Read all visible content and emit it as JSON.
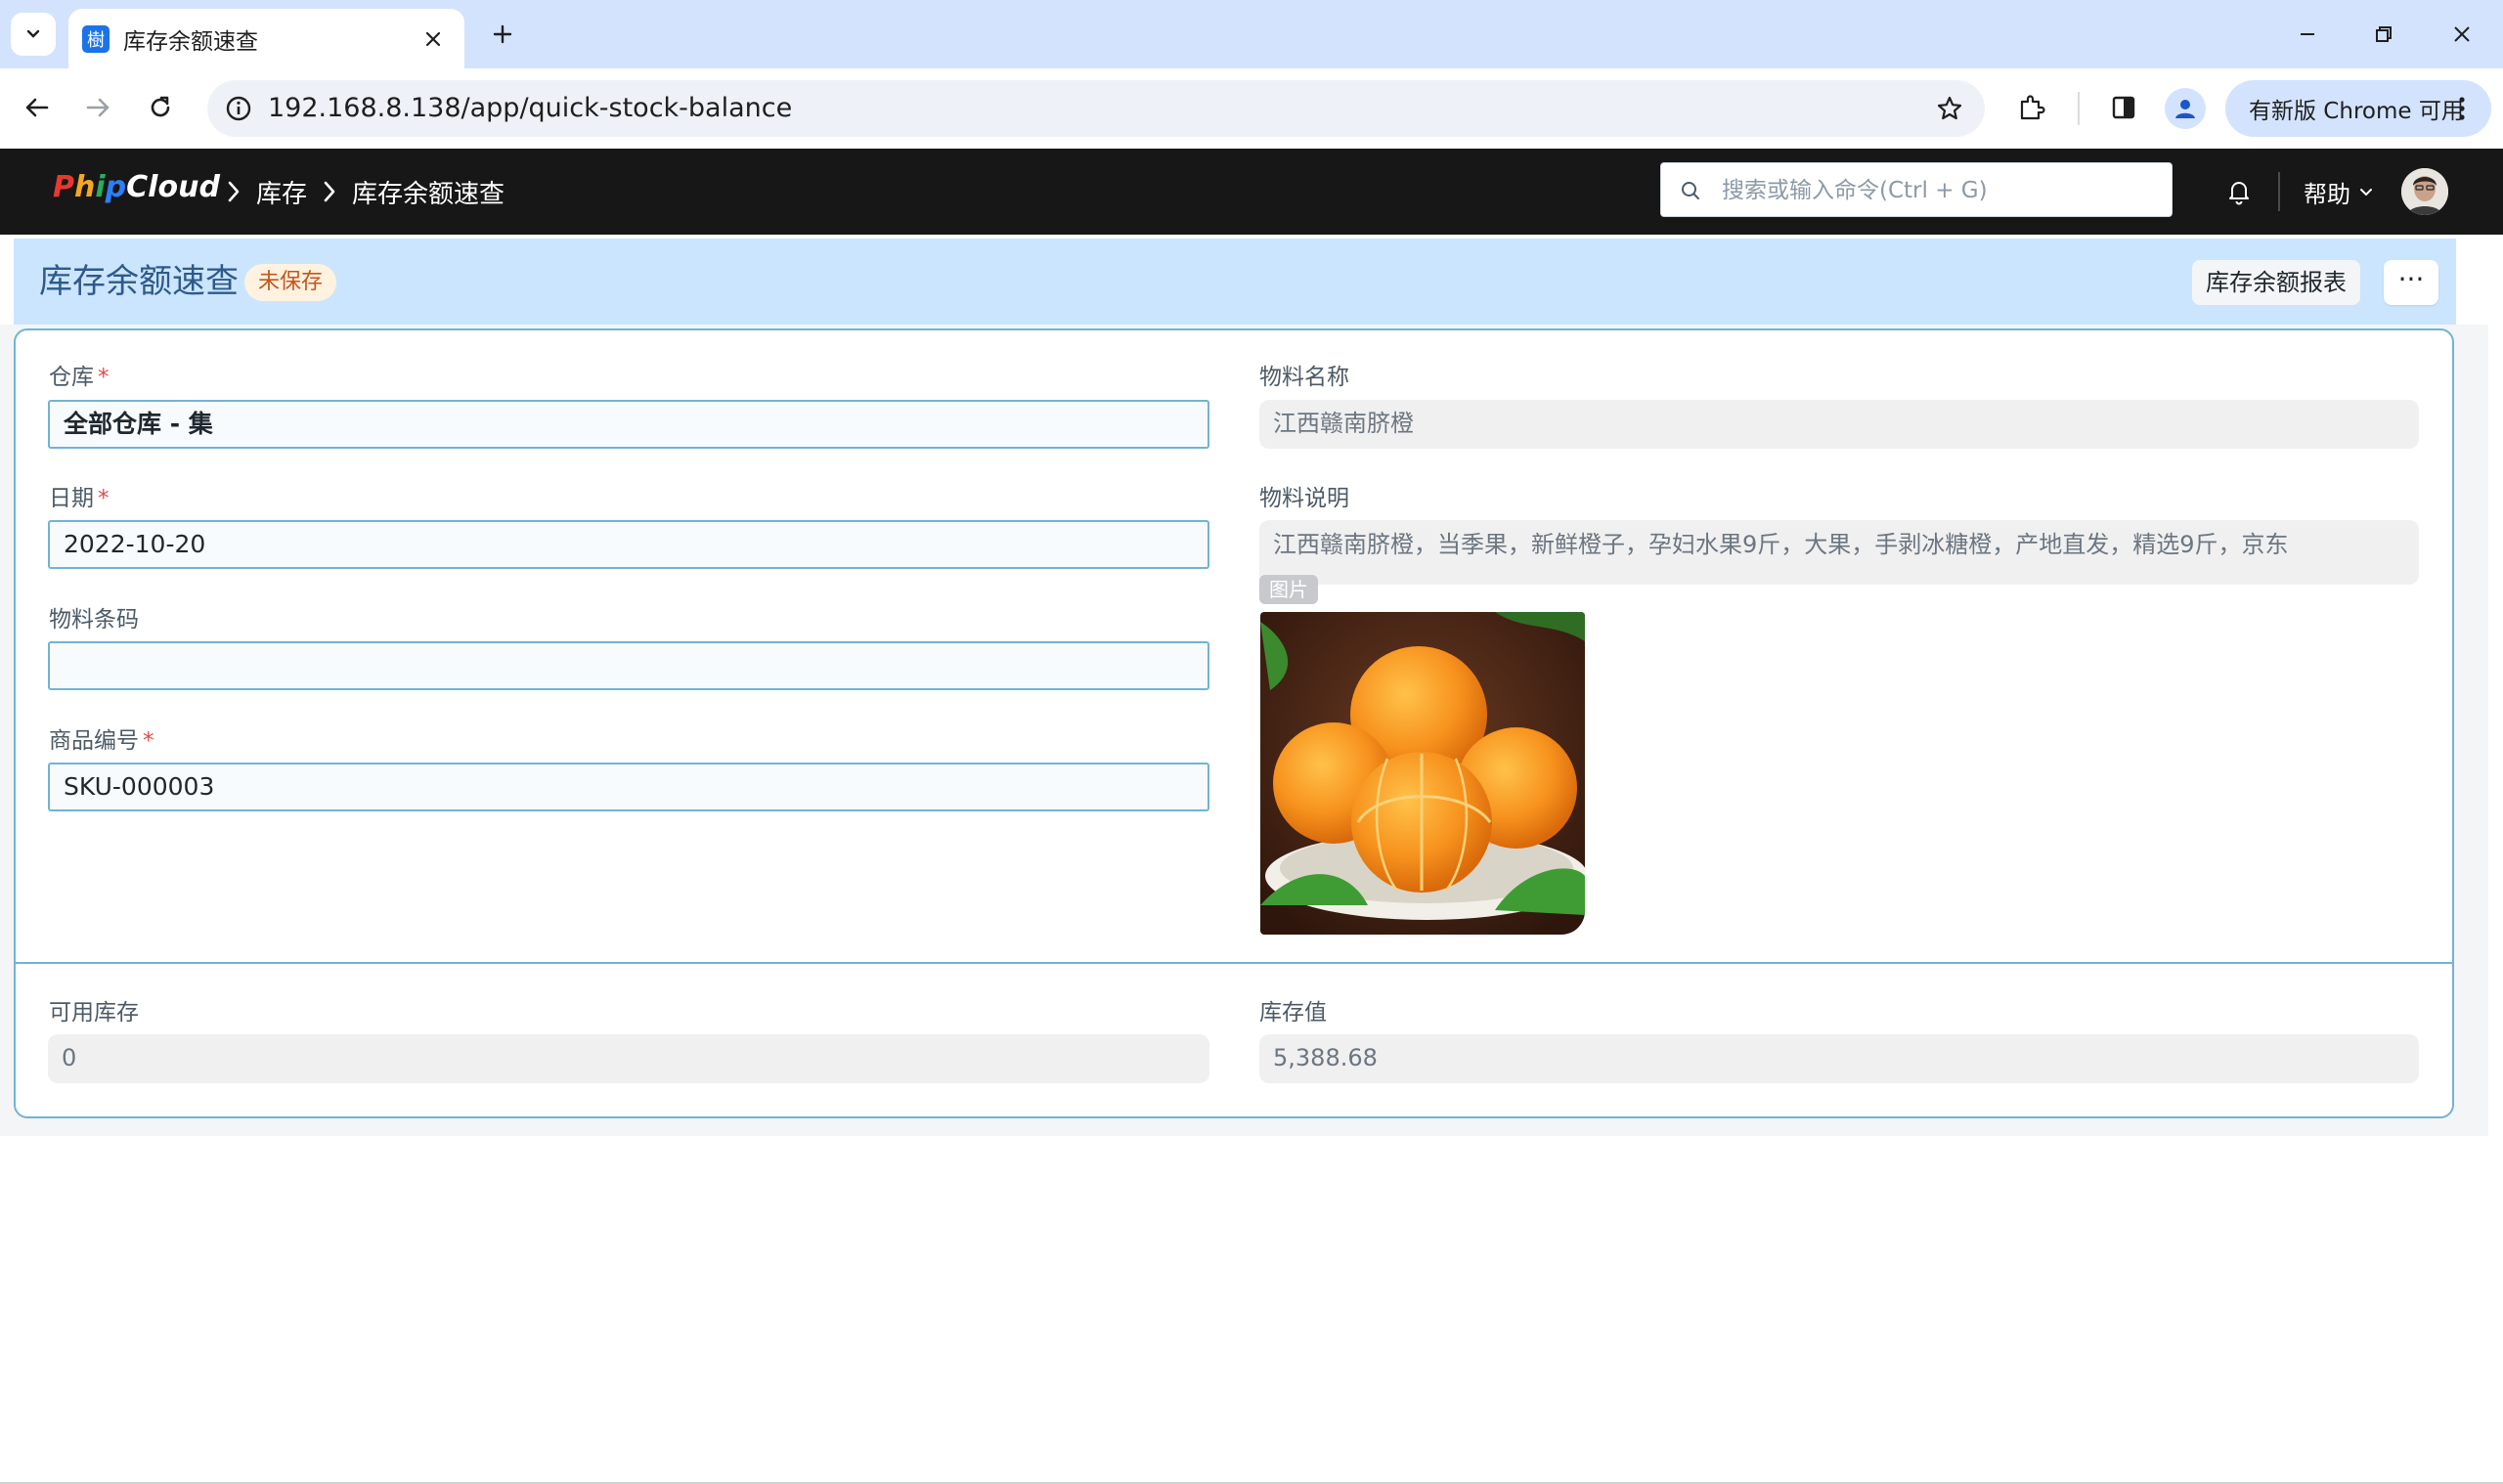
{
  "browser": {
    "tab_title": "库存余额速查",
    "favicon_text": "樹",
    "url": "192.168.8.138/app/quick-stock-balance",
    "update_label": "有新版 Chrome 可用"
  },
  "navbar": {
    "logo": [
      "P",
      "h",
      "i",
      "p",
      "C",
      "l",
      "o",
      "u",
      "d"
    ],
    "logo_colors": [
      "#e8392f",
      "#f5a623",
      "#27ae60",
      "#2d7ff9",
      "#ffffff",
      "#ffffff",
      "#ffffff",
      "#ffffff",
      "#ffffff"
    ],
    "breadcrumbs": [
      "库存",
      "库存余额速查"
    ],
    "search_placeholder": "搜索或输入命令(Ctrl + G)",
    "help_label": "帮助"
  },
  "page": {
    "title": "库存余额速查",
    "status_indicator": "未保存",
    "report_button": "库存余额报表",
    "more_button": "···"
  },
  "form": {
    "warehouse": {
      "label": "仓库",
      "value": "全部仓库 - 集"
    },
    "date": {
      "label": "日期",
      "value": "2022-10-20"
    },
    "item_barcode": {
      "label": "物料条码",
      "value": ""
    },
    "item_code": {
      "label": "商品编号",
      "value": "SKU-000003"
    },
    "item_name": {
      "label": "物料名称",
      "value": "江西赣南脐橙"
    },
    "item_description": {
      "label": "物料说明",
      "value": "江西赣南脐橙，当季果，新鲜橙子，孕妇水果9斤，大果，手剥冰糖橙，产地直发，精选9斤，京东"
    },
    "image_tag": "图片",
    "available_qty": {
      "label": "可用库存",
      "value": "0"
    },
    "stock_value": {
      "label": "库存值",
      "value": "5,388.68"
    }
  },
  "colors": {
    "navbar_bg": "#171717",
    "page_head_bg": "#cce5ff",
    "input_border": "#71b3d6",
    "indicator_text": "#c4551b",
    "required": "#e24c4c"
  }
}
